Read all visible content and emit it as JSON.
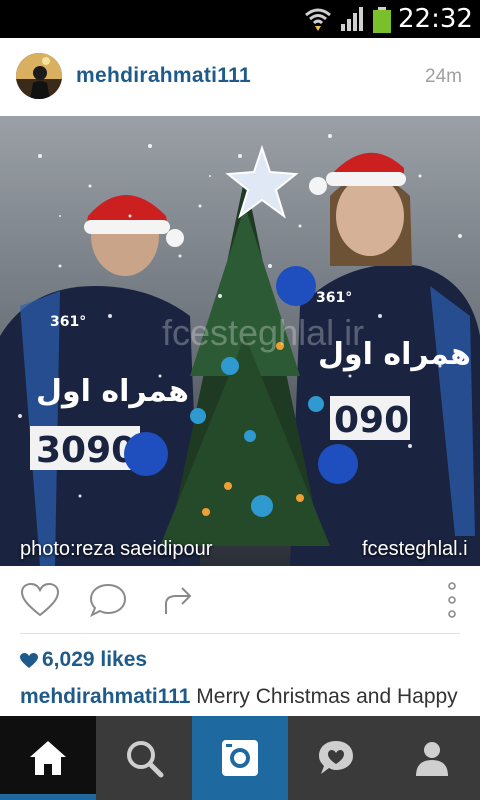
{
  "status_bar": {
    "time": "22:32",
    "icons": [
      "wifi-icon",
      "signal-icon",
      "battery-icon"
    ]
  },
  "post": {
    "username": "mehdirahmati111",
    "time_ago": "24m",
    "photo": {
      "credit": "photo:reza saeidipour",
      "watermark_corner": "fcesteghlal.i",
      "watermark_center": "fcesteghlal.ir",
      "jersey_text": "3090",
      "sponsor_logo": "همراه اول",
      "brand": "361°"
    },
    "actions": [
      "like-icon",
      "comment-icon",
      "share-icon",
      "more-icon"
    ],
    "likes": "6,029 likes",
    "caption_user": "mehdirahmati111",
    "caption_text": "Merry Christmas and Happy"
  },
  "bottom_nav": {
    "items": [
      "home-icon",
      "search-icon",
      "camera-icon",
      "activity-icon",
      "profile-icon"
    ],
    "active": "home-icon"
  },
  "colors": {
    "accent": "#1e5a8a",
    "nav_active": "#1e6aa0",
    "nav_bg": "#3a3a3a",
    "jersey": "#1a2340"
  }
}
